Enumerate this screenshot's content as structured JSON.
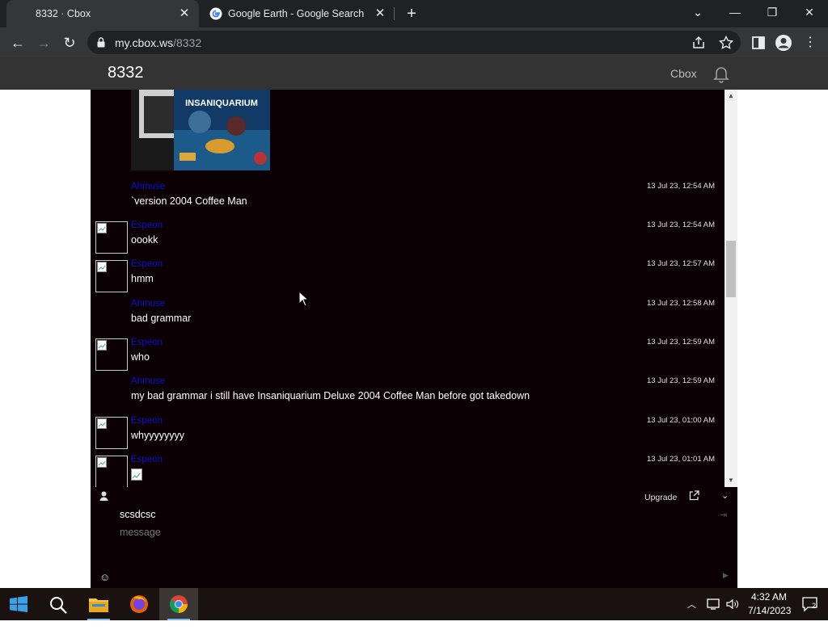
{
  "browser": {
    "tabs": [
      {
        "title": "8332 · Cbox",
        "active": true
      },
      {
        "title": "Google Earth - Google Search",
        "active": false
      }
    ],
    "url_host": "my.cbox.ws",
    "url_path": "/8332"
  },
  "site": {
    "title": "8332",
    "cbox_link": "Cbox"
  },
  "messages": [
    {
      "type": "image",
      "user": "",
      "text": "",
      "time": ""
    },
    {
      "type": "text",
      "user": "Ahmuse",
      "text": "`version 2004 Coffee Man",
      "time": "13 Jul 23, 12:54 AM",
      "avatar": false
    },
    {
      "type": "text",
      "user": "Espeon",
      "text": "oookk",
      "time": "13 Jul 23, 12:54 AM",
      "avatar": true
    },
    {
      "type": "text",
      "user": "Espeon",
      "text": "hmm",
      "time": "13 Jul 23, 12:57 AM",
      "avatar": true
    },
    {
      "type": "text",
      "user": "Ahmuse",
      "text": "bad grammar",
      "time": "13 Jul 23, 12:58 AM",
      "avatar": false
    },
    {
      "type": "text",
      "user": "Espeon",
      "text": "who",
      "time": "13 Jul 23, 12:59 AM",
      "avatar": true
    },
    {
      "type": "text",
      "user": "Ahmuse",
      "text": "my bad grammar i still have Insaniquarium Deluxe 2004 Coffee Man before got takedown",
      "time": "13 Jul 23, 12:59 AM",
      "avatar": false
    },
    {
      "type": "text",
      "user": "Espeon",
      "text": "whyyyyyyyy",
      "time": "13 Jul 23, 01:00 AM",
      "avatar": true
    },
    {
      "type": "text",
      "user": "Espeon",
      "text": "",
      "time": "13 Jul 23, 01:01 AM",
      "avatar": true
    }
  ],
  "image_caption": "INSANIQUARIUM",
  "input": {
    "upgrade_label": "Upgrade",
    "name_value": "scsdcsc",
    "message_placeholder": "message"
  },
  "taskbar": {
    "time": "4:32 AM",
    "date": "7/14/2023",
    "notification_count": "2"
  }
}
